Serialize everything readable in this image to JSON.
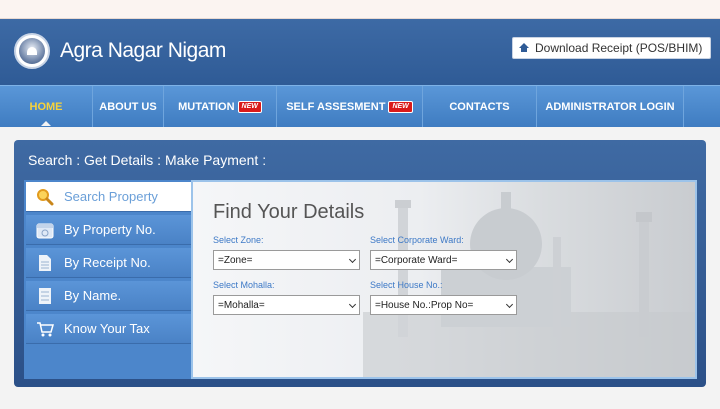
{
  "header": {
    "site_title": "Agra Nagar Nigam",
    "download_label": "Download Receipt (POS/BHIM)"
  },
  "nav": {
    "items": [
      {
        "label": "HOME",
        "active": true,
        "badge": ""
      },
      {
        "label": "ABOUT US",
        "active": false,
        "badge": ""
      },
      {
        "label": "MUTATION",
        "active": false,
        "badge": "NEW"
      },
      {
        "label": "SELF ASSESMENT",
        "active": false,
        "badge": "NEW"
      },
      {
        "label": "CONTACTS",
        "active": false,
        "badge": ""
      },
      {
        "label": "ADMINISTRATOR LOGIN",
        "active": false,
        "badge": ""
      }
    ]
  },
  "panel": {
    "title": "Search : Get Details : Make Payment :"
  },
  "menu": {
    "items": [
      {
        "label": "Search Property",
        "icon": "search-icon",
        "active": true
      },
      {
        "label": "By Property No.",
        "icon": "calendar-icon",
        "active": false
      },
      {
        "label": "By Receipt No.",
        "icon": "document-icon",
        "active": false
      },
      {
        "label": "By Name.",
        "icon": "list-icon",
        "active": false
      },
      {
        "label": "Know Your Tax",
        "icon": "cart-icon",
        "active": false
      }
    ]
  },
  "form": {
    "title": "Find Your Details",
    "zone_label": "Select Zone:",
    "zone_value": "=Zone=",
    "ward_label": "Select Corporate Ward:",
    "ward_value": "=Corporate Ward=",
    "mohalla_label": "Select Mohalla:",
    "mohalla_value": "=Mohalla=",
    "house_label": "Select House No.:",
    "house_value": "=House No.:Prop No="
  },
  "colors": {
    "header_blue": "#2f5b96",
    "nav_blue": "#4a89cf",
    "active_nav": "#f7d23a",
    "badge_red": "#d91a1a",
    "label_blue": "#3d79c6"
  }
}
